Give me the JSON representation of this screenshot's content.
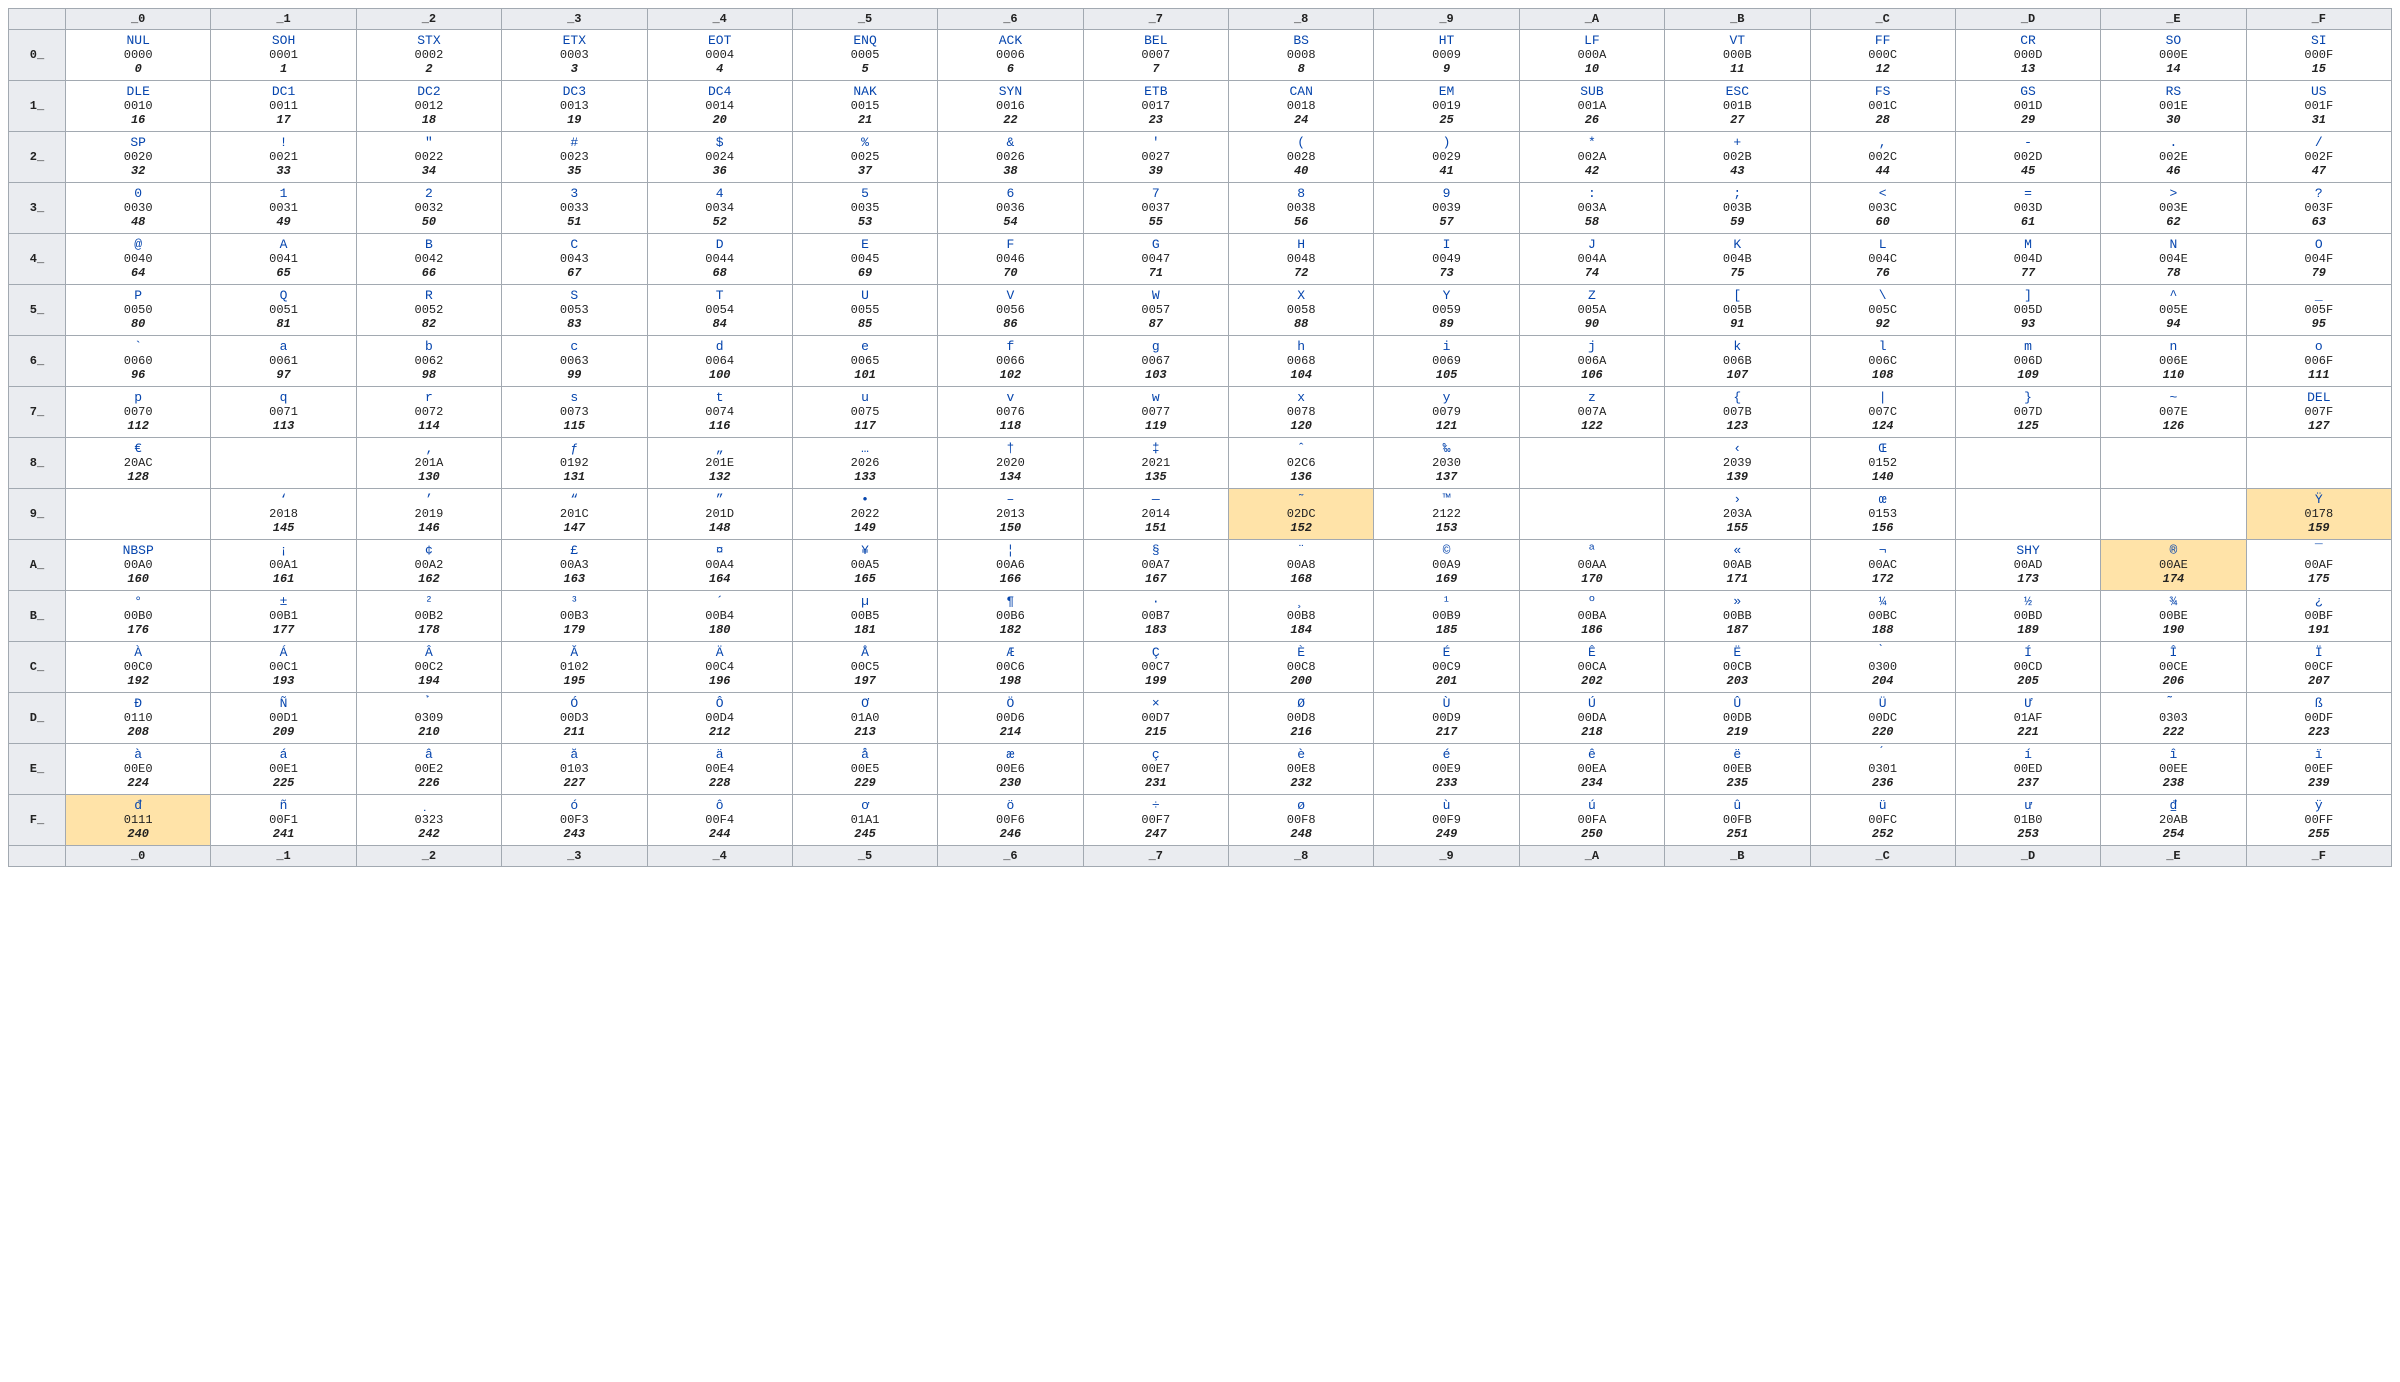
{
  "columns": [
    "_0",
    "_1",
    "_2",
    "_3",
    "_4",
    "_5",
    "_6",
    "_7",
    "_8",
    "_9",
    "_A",
    "_B",
    "_C",
    "_D",
    "_E",
    "_F"
  ],
  "rows": {
    "0_": [
      {
        "g": "NUL",
        "h": "0000",
        "d": "0"
      },
      {
        "g": "SOH",
        "h": "0001",
        "d": "1"
      },
      {
        "g": "STX",
        "h": "0002",
        "d": "2"
      },
      {
        "g": "ETX",
        "h": "0003",
        "d": "3"
      },
      {
        "g": "EOT",
        "h": "0004",
        "d": "4"
      },
      {
        "g": "ENQ",
        "h": "0005",
        "d": "5"
      },
      {
        "g": "ACK",
        "h": "0006",
        "d": "6"
      },
      {
        "g": "BEL",
        "h": "0007",
        "d": "7"
      },
      {
        "g": "BS",
        "h": "0008",
        "d": "8"
      },
      {
        "g": "HT",
        "h": "0009",
        "d": "9"
      },
      {
        "g": "LF",
        "h": "000A",
        "d": "10"
      },
      {
        "g": "VT",
        "h": "000B",
        "d": "11"
      },
      {
        "g": "FF",
        "h": "000C",
        "d": "12"
      },
      {
        "g": "CR",
        "h": "000D",
        "d": "13"
      },
      {
        "g": "SO",
        "h": "000E",
        "d": "14"
      },
      {
        "g": "SI",
        "h": "000F",
        "d": "15"
      }
    ],
    "1_": [
      {
        "g": "DLE",
        "h": "0010",
        "d": "16"
      },
      {
        "g": "DC1",
        "h": "0011",
        "d": "17"
      },
      {
        "g": "DC2",
        "h": "0012",
        "d": "18"
      },
      {
        "g": "DC3",
        "h": "0013",
        "d": "19"
      },
      {
        "g": "DC4",
        "h": "0014",
        "d": "20"
      },
      {
        "g": "NAK",
        "h": "0015",
        "d": "21"
      },
      {
        "g": "SYN",
        "h": "0016",
        "d": "22"
      },
      {
        "g": "ETB",
        "h": "0017",
        "d": "23"
      },
      {
        "g": "CAN",
        "h": "0018",
        "d": "24"
      },
      {
        "g": "EM",
        "h": "0019",
        "d": "25"
      },
      {
        "g": "SUB",
        "h": "001A",
        "d": "26"
      },
      {
        "g": "ESC",
        "h": "001B",
        "d": "27"
      },
      {
        "g": "FS",
        "h": "001C",
        "d": "28"
      },
      {
        "g": "GS",
        "h": "001D",
        "d": "29"
      },
      {
        "g": "RS",
        "h": "001E",
        "d": "30"
      },
      {
        "g": "US",
        "h": "001F",
        "d": "31"
      }
    ],
    "2_": [
      {
        "g": "SP",
        "h": "0020",
        "d": "32"
      },
      {
        "g": "!",
        "h": "0021",
        "d": "33"
      },
      {
        "g": "\"",
        "h": "0022",
        "d": "34"
      },
      {
        "g": "#",
        "h": "0023",
        "d": "35"
      },
      {
        "g": "$",
        "h": "0024",
        "d": "36"
      },
      {
        "g": "%",
        "h": "0025",
        "d": "37"
      },
      {
        "g": "&",
        "h": "0026",
        "d": "38"
      },
      {
        "g": "'",
        "h": "0027",
        "d": "39"
      },
      {
        "g": "(",
        "h": "0028",
        "d": "40"
      },
      {
        "g": ")",
        "h": "0029",
        "d": "41"
      },
      {
        "g": "*",
        "h": "002A",
        "d": "42"
      },
      {
        "g": "+",
        "h": "002B",
        "d": "43"
      },
      {
        "g": ",",
        "h": "002C",
        "d": "44"
      },
      {
        "g": "-",
        "h": "002D",
        "d": "45"
      },
      {
        "g": ".",
        "h": "002E",
        "d": "46"
      },
      {
        "g": "/",
        "h": "002F",
        "d": "47"
      }
    ],
    "3_": [
      {
        "g": "0",
        "h": "0030",
        "d": "48"
      },
      {
        "g": "1",
        "h": "0031",
        "d": "49"
      },
      {
        "g": "2",
        "h": "0032",
        "d": "50"
      },
      {
        "g": "3",
        "h": "0033",
        "d": "51"
      },
      {
        "g": "4",
        "h": "0034",
        "d": "52"
      },
      {
        "g": "5",
        "h": "0035",
        "d": "53"
      },
      {
        "g": "6",
        "h": "0036",
        "d": "54"
      },
      {
        "g": "7",
        "h": "0037",
        "d": "55"
      },
      {
        "g": "8",
        "h": "0038",
        "d": "56"
      },
      {
        "g": "9",
        "h": "0039",
        "d": "57"
      },
      {
        "g": ":",
        "h": "003A",
        "d": "58"
      },
      {
        "g": ";",
        "h": "003B",
        "d": "59"
      },
      {
        "g": "<",
        "h": "003C",
        "d": "60"
      },
      {
        "g": "=",
        "h": "003D",
        "d": "61"
      },
      {
        "g": ">",
        "h": "003E",
        "d": "62"
      },
      {
        "g": "?",
        "h": "003F",
        "d": "63"
      }
    ],
    "4_": [
      {
        "g": "@",
        "h": "0040",
        "d": "64"
      },
      {
        "g": "A",
        "h": "0041",
        "d": "65"
      },
      {
        "g": "B",
        "h": "0042",
        "d": "66"
      },
      {
        "g": "C",
        "h": "0043",
        "d": "67"
      },
      {
        "g": "D",
        "h": "0044",
        "d": "68"
      },
      {
        "g": "E",
        "h": "0045",
        "d": "69"
      },
      {
        "g": "F",
        "h": "0046",
        "d": "70"
      },
      {
        "g": "G",
        "h": "0047",
        "d": "71"
      },
      {
        "g": "H",
        "h": "0048",
        "d": "72"
      },
      {
        "g": "I",
        "h": "0049",
        "d": "73"
      },
      {
        "g": "J",
        "h": "004A",
        "d": "74"
      },
      {
        "g": "K",
        "h": "004B",
        "d": "75"
      },
      {
        "g": "L",
        "h": "004C",
        "d": "76"
      },
      {
        "g": "M",
        "h": "004D",
        "d": "77"
      },
      {
        "g": "N",
        "h": "004E",
        "d": "78"
      },
      {
        "g": "O",
        "h": "004F",
        "d": "79"
      }
    ],
    "5_": [
      {
        "g": "P",
        "h": "0050",
        "d": "80"
      },
      {
        "g": "Q",
        "h": "0051",
        "d": "81"
      },
      {
        "g": "R",
        "h": "0052",
        "d": "82"
      },
      {
        "g": "S",
        "h": "0053",
        "d": "83"
      },
      {
        "g": "T",
        "h": "0054",
        "d": "84"
      },
      {
        "g": "U",
        "h": "0055",
        "d": "85"
      },
      {
        "g": "V",
        "h": "0056",
        "d": "86"
      },
      {
        "g": "W",
        "h": "0057",
        "d": "87"
      },
      {
        "g": "X",
        "h": "0058",
        "d": "88"
      },
      {
        "g": "Y",
        "h": "0059",
        "d": "89"
      },
      {
        "g": "Z",
        "h": "005A",
        "d": "90"
      },
      {
        "g": "[",
        "h": "005B",
        "d": "91"
      },
      {
        "g": "\\",
        "h": "005C",
        "d": "92"
      },
      {
        "g": "]",
        "h": "005D",
        "d": "93"
      },
      {
        "g": "^",
        "h": "005E",
        "d": "94"
      },
      {
        "g": "_",
        "h": "005F",
        "d": "95"
      }
    ],
    "6_": [
      {
        "g": "`",
        "h": "0060",
        "d": "96"
      },
      {
        "g": "a",
        "h": "0061",
        "d": "97"
      },
      {
        "g": "b",
        "h": "0062",
        "d": "98"
      },
      {
        "g": "c",
        "h": "0063",
        "d": "99"
      },
      {
        "g": "d",
        "h": "0064",
        "d": "100"
      },
      {
        "g": "e",
        "h": "0065",
        "d": "101"
      },
      {
        "g": "f",
        "h": "0066",
        "d": "102"
      },
      {
        "g": "g",
        "h": "0067",
        "d": "103"
      },
      {
        "g": "h",
        "h": "0068",
        "d": "104"
      },
      {
        "g": "i",
        "h": "0069",
        "d": "105"
      },
      {
        "g": "j",
        "h": "006A",
        "d": "106"
      },
      {
        "g": "k",
        "h": "006B",
        "d": "107"
      },
      {
        "g": "l",
        "h": "006C",
        "d": "108"
      },
      {
        "g": "m",
        "h": "006D",
        "d": "109"
      },
      {
        "g": "n",
        "h": "006E",
        "d": "110"
      },
      {
        "g": "o",
        "h": "006F",
        "d": "111"
      }
    ],
    "7_": [
      {
        "g": "p",
        "h": "0070",
        "d": "112"
      },
      {
        "g": "q",
        "h": "0071",
        "d": "113"
      },
      {
        "g": "r",
        "h": "0072",
        "d": "114"
      },
      {
        "g": "s",
        "h": "0073",
        "d": "115"
      },
      {
        "g": "t",
        "h": "0074",
        "d": "116"
      },
      {
        "g": "u",
        "h": "0075",
        "d": "117"
      },
      {
        "g": "v",
        "h": "0076",
        "d": "118"
      },
      {
        "g": "w",
        "h": "0077",
        "d": "119"
      },
      {
        "g": "x",
        "h": "0078",
        "d": "120"
      },
      {
        "g": "y",
        "h": "0079",
        "d": "121"
      },
      {
        "g": "z",
        "h": "007A",
        "d": "122"
      },
      {
        "g": "{",
        "h": "007B",
        "d": "123"
      },
      {
        "g": "|",
        "h": "007C",
        "d": "124"
      },
      {
        "g": "}",
        "h": "007D",
        "d": "125"
      },
      {
        "g": "~",
        "h": "007E",
        "d": "126"
      },
      {
        "g": "DEL",
        "h": "007F",
        "d": "127"
      }
    ],
    "8_": [
      {
        "g": "€",
        "h": "20AC",
        "d": "128"
      },
      {
        "empty": true
      },
      {
        "g": "‚",
        "h": "201A",
        "d": "130"
      },
      {
        "g": "ƒ",
        "h": "0192",
        "d": "131"
      },
      {
        "g": "„",
        "h": "201E",
        "d": "132"
      },
      {
        "g": "…",
        "h": "2026",
        "d": "133"
      },
      {
        "g": "†",
        "h": "2020",
        "d": "134"
      },
      {
        "g": "‡",
        "h": "2021",
        "d": "135"
      },
      {
        "g": "ˆ",
        "h": "02C6",
        "d": "136"
      },
      {
        "g": "‰",
        "h": "2030",
        "d": "137"
      },
      {
        "empty": true
      },
      {
        "g": "‹",
        "h": "2039",
        "d": "139"
      },
      {
        "g": "Œ",
        "h": "0152",
        "d": "140"
      },
      {
        "empty": true
      },
      {
        "empty": true
      },
      {
        "empty": true
      }
    ],
    "9_": [
      {
        "empty": true
      },
      {
        "g": "‘",
        "h": "2018",
        "d": "145"
      },
      {
        "g": "’",
        "h": "2019",
        "d": "146"
      },
      {
        "g": "“",
        "h": "201C",
        "d": "147"
      },
      {
        "g": "”",
        "h": "201D",
        "d": "148"
      },
      {
        "g": "•",
        "h": "2022",
        "d": "149"
      },
      {
        "g": "–",
        "h": "2013",
        "d": "150"
      },
      {
        "g": "—",
        "h": "2014",
        "d": "151"
      },
      {
        "g": "˜",
        "h": "02DC",
        "d": "152",
        "hl": true
      },
      {
        "g": "™",
        "h": "2122",
        "d": "153"
      },
      {
        "empty": true
      },
      {
        "g": "›",
        "h": "203A",
        "d": "155"
      },
      {
        "g": "œ",
        "h": "0153",
        "d": "156"
      },
      {
        "empty": true
      },
      {
        "empty": true
      },
      {
        "g": "Ÿ",
        "h": "0178",
        "d": "159",
        "hl": true
      }
    ],
    "A_": [
      {
        "g": "NBSP",
        "h": "00A0",
        "d": "160"
      },
      {
        "g": "¡",
        "h": "00A1",
        "d": "161"
      },
      {
        "g": "¢",
        "h": "00A2",
        "d": "162"
      },
      {
        "g": "£",
        "h": "00A3",
        "d": "163"
      },
      {
        "g": "¤",
        "h": "00A4",
        "d": "164"
      },
      {
        "g": "¥",
        "h": "00A5",
        "d": "165"
      },
      {
        "g": "¦",
        "h": "00A6",
        "d": "166"
      },
      {
        "g": "§",
        "h": "00A7",
        "d": "167"
      },
      {
        "g": "¨",
        "h": "00A8",
        "d": "168"
      },
      {
        "g": "©",
        "h": "00A9",
        "d": "169"
      },
      {
        "g": "ª",
        "h": "00AA",
        "d": "170"
      },
      {
        "g": "«",
        "h": "00AB",
        "d": "171"
      },
      {
        "g": "¬",
        "h": "00AC",
        "d": "172"
      },
      {
        "g": "SHY",
        "h": "00AD",
        "d": "173"
      },
      {
        "g": "®",
        "h": "00AE",
        "d": "174",
        "hl": true
      },
      {
        "g": "¯",
        "h": "00AF",
        "d": "175"
      }
    ],
    "B_": [
      {
        "g": "°",
        "h": "00B0",
        "d": "176"
      },
      {
        "g": "±",
        "h": "00B1",
        "d": "177"
      },
      {
        "g": "²",
        "h": "00B2",
        "d": "178"
      },
      {
        "g": "³",
        "h": "00B3",
        "d": "179"
      },
      {
        "g": "´",
        "h": "00B4",
        "d": "180"
      },
      {
        "g": "µ",
        "h": "00B5",
        "d": "181"
      },
      {
        "g": "¶",
        "h": "00B6",
        "d": "182"
      },
      {
        "g": "·",
        "h": "00B7",
        "d": "183"
      },
      {
        "g": "¸",
        "h": "00B8",
        "d": "184"
      },
      {
        "g": "¹",
        "h": "00B9",
        "d": "185"
      },
      {
        "g": "º",
        "h": "00BA",
        "d": "186"
      },
      {
        "g": "»",
        "h": "00BB",
        "d": "187"
      },
      {
        "g": "¼",
        "h": "00BC",
        "d": "188"
      },
      {
        "g": "½",
        "h": "00BD",
        "d": "189"
      },
      {
        "g": "¾",
        "h": "00BE",
        "d": "190"
      },
      {
        "g": "¿",
        "h": "00BF",
        "d": "191"
      }
    ],
    "C_": [
      {
        "g": "À",
        "h": "00C0",
        "d": "192"
      },
      {
        "g": "Á",
        "h": "00C1",
        "d": "193"
      },
      {
        "g": "Â",
        "h": "00C2",
        "d": "194"
      },
      {
        "g": "Ă",
        "h": "0102",
        "d": "195"
      },
      {
        "g": "Ä",
        "h": "00C4",
        "d": "196"
      },
      {
        "g": "Å",
        "h": "00C5",
        "d": "197"
      },
      {
        "g": "Æ",
        "h": "00C6",
        "d": "198"
      },
      {
        "g": "Ç",
        "h": "00C7",
        "d": "199"
      },
      {
        "g": "È",
        "h": "00C8",
        "d": "200"
      },
      {
        "g": "É",
        "h": "00C9",
        "d": "201"
      },
      {
        "g": "Ê",
        "h": "00CA",
        "d": "202"
      },
      {
        "g": "Ë",
        "h": "00CB",
        "d": "203"
      },
      {
        "g": "̀",
        "h": "0300",
        "d": "204"
      },
      {
        "g": "Í",
        "h": "00CD",
        "d": "205"
      },
      {
        "g": "Î",
        "h": "00CE",
        "d": "206"
      },
      {
        "g": "Ï",
        "h": "00CF",
        "d": "207"
      }
    ],
    "D_": [
      {
        "g": "Đ",
        "h": "0110",
        "d": "208"
      },
      {
        "g": "Ñ",
        "h": "00D1",
        "d": "209"
      },
      {
        "g": "̉",
        "h": "0309",
        "d": "210"
      },
      {
        "g": "Ó",
        "h": "00D3",
        "d": "211"
      },
      {
        "g": "Ô",
        "h": "00D4",
        "d": "212"
      },
      {
        "g": "Ơ",
        "h": "01A0",
        "d": "213"
      },
      {
        "g": "Ö",
        "h": "00D6",
        "d": "214"
      },
      {
        "g": "×",
        "h": "00D7",
        "d": "215"
      },
      {
        "g": "Ø",
        "h": "00D8",
        "d": "216"
      },
      {
        "g": "Ù",
        "h": "00D9",
        "d": "217"
      },
      {
        "g": "Ú",
        "h": "00DA",
        "d": "218"
      },
      {
        "g": "Û",
        "h": "00DB",
        "d": "219"
      },
      {
        "g": "Ü",
        "h": "00DC",
        "d": "220"
      },
      {
        "g": "Ư",
        "h": "01AF",
        "d": "221"
      },
      {
        "g": "̃",
        "h": "0303",
        "d": "222"
      },
      {
        "g": "ß",
        "h": "00DF",
        "d": "223"
      }
    ],
    "E_": [
      {
        "g": "à",
        "h": "00E0",
        "d": "224"
      },
      {
        "g": "á",
        "h": "00E1",
        "d": "225"
      },
      {
        "g": "â",
        "h": "00E2",
        "d": "226"
      },
      {
        "g": "ă",
        "h": "0103",
        "d": "227"
      },
      {
        "g": "ä",
        "h": "00E4",
        "d": "228"
      },
      {
        "g": "å",
        "h": "00E5",
        "d": "229"
      },
      {
        "g": "æ",
        "h": "00E6",
        "d": "230"
      },
      {
        "g": "ç",
        "h": "00E7",
        "d": "231"
      },
      {
        "g": "è",
        "h": "00E8",
        "d": "232"
      },
      {
        "g": "é",
        "h": "00E9",
        "d": "233"
      },
      {
        "g": "ê",
        "h": "00EA",
        "d": "234"
      },
      {
        "g": "ë",
        "h": "00EB",
        "d": "235"
      },
      {
        "g": "́",
        "h": "0301",
        "d": "236"
      },
      {
        "g": "í",
        "h": "00ED",
        "d": "237"
      },
      {
        "g": "î",
        "h": "00EE",
        "d": "238"
      },
      {
        "g": "ï",
        "h": "00EF",
        "d": "239"
      }
    ],
    "F_": [
      {
        "g": "đ",
        "h": "0111",
        "d": "240",
        "hl": true
      },
      {
        "g": "ñ",
        "h": "00F1",
        "d": "241"
      },
      {
        "g": "̣",
        "h": "0323",
        "d": "242"
      },
      {
        "g": "ó",
        "h": "00F3",
        "d": "243"
      },
      {
        "g": "ô",
        "h": "00F4",
        "d": "244"
      },
      {
        "g": "ơ",
        "h": "01A1",
        "d": "245"
      },
      {
        "g": "ö",
        "h": "00F6",
        "d": "246"
      },
      {
        "g": "÷",
        "h": "00F7",
        "d": "247"
      },
      {
        "g": "ø",
        "h": "00F8",
        "d": "248"
      },
      {
        "g": "ù",
        "h": "00F9",
        "d": "249"
      },
      {
        "g": "ú",
        "h": "00FA",
        "d": "250"
      },
      {
        "g": "û",
        "h": "00FB",
        "d": "251"
      },
      {
        "g": "ü",
        "h": "00FC",
        "d": "252"
      },
      {
        "g": "ư",
        "h": "01B0",
        "d": "253"
      },
      {
        "g": "₫",
        "h": "20AB",
        "d": "254"
      },
      {
        "g": "ÿ",
        "h": "00FF",
        "d": "255"
      }
    ]
  },
  "rowOrder": [
    "0_",
    "1_",
    "2_",
    "3_",
    "4_",
    "5_",
    "6_",
    "7_",
    "8_",
    "9_",
    "A_",
    "B_",
    "C_",
    "D_",
    "E_",
    "F_"
  ]
}
